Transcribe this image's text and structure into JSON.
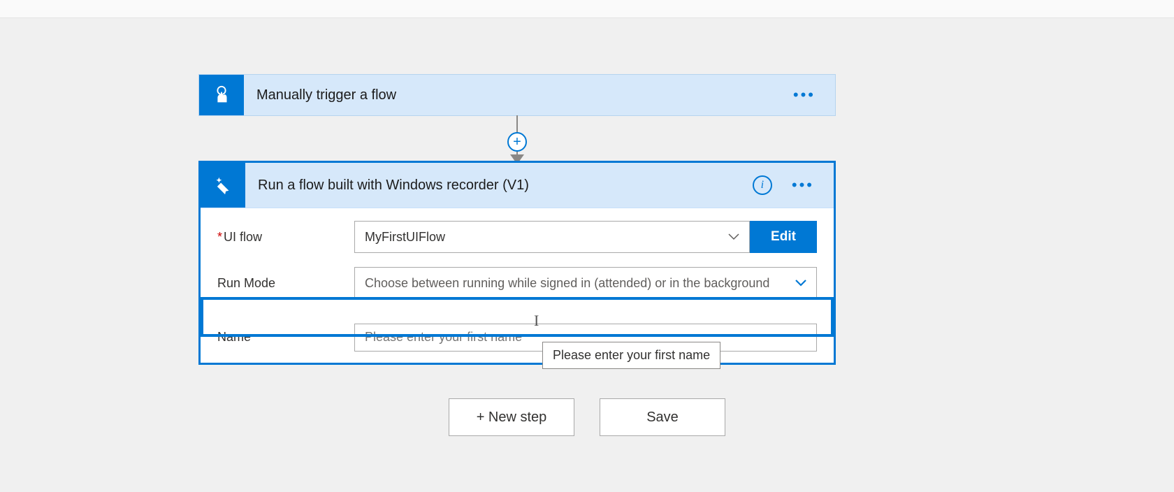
{
  "trigger": {
    "title": "Manually trigger a flow"
  },
  "action": {
    "title": "Run a flow built with Windows recorder (V1)",
    "fields": {
      "uiflow_label": "UI flow",
      "uiflow_value": "MyFirstUIFlow",
      "edit_label": "Edit",
      "runmode_label": "Run Mode",
      "runmode_placeholder": "Choose between running while signed in (attended) or in the background",
      "name_label": "Name",
      "name_placeholder": "Please enter your first name"
    }
  },
  "tooltip": "Please enter your first name",
  "buttons": {
    "new_step": "+ New step",
    "save": "Save"
  }
}
